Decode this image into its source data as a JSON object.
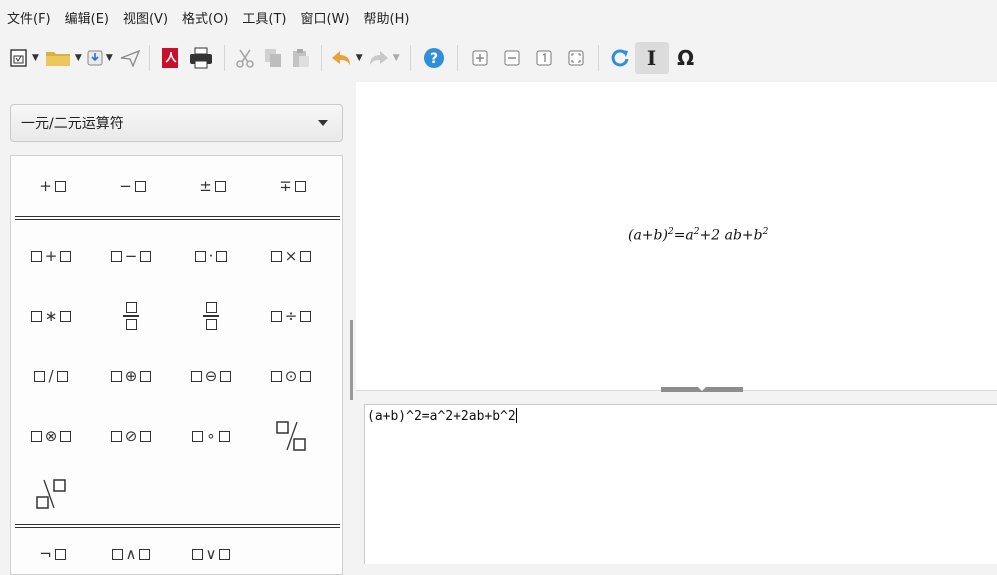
{
  "menu": [
    "文件(F)",
    "编辑(E)",
    "视图(V)",
    "格式(O)",
    "工具(T)",
    "窗口(W)",
    "帮助(H)"
  ],
  "toolbar": {
    "icons": [
      "new-document-icon",
      "open-folder-icon",
      "save-icon",
      "send-icon",
      "export-pdf-icon",
      "print-icon",
      "cut-icon",
      "copy-icon",
      "paste-icon",
      "undo-icon",
      "redo-icon",
      "help-icon",
      "zoom-in-icon",
      "zoom-out-icon",
      "actual-size-icon",
      "fit-page-icon",
      "refresh-icon",
      "formula-cursor-icon",
      "symbols-icon"
    ],
    "formula_cursor_label": "I",
    "symbols_label": "Ω"
  },
  "category": {
    "selected": "一元/二元运算符"
  },
  "palette": {
    "unary": [
      "+",
      "−",
      "±",
      "∓"
    ],
    "binary_row1": [
      "+",
      "−",
      "·",
      "×"
    ],
    "binary_row2": [
      "∗",
      "÷"
    ],
    "binary_row3": [
      "/",
      "⊕",
      "⊖",
      "⊙"
    ],
    "binary_row4": [
      "⊗",
      "⊘",
      "∘"
    ],
    "logic": [
      "¬",
      "∧",
      "∨"
    ]
  },
  "preview": {
    "lhs": "(a+b)",
    "exp1": "2",
    "eq": "=a",
    "exp2": "2",
    "mid": "+2 ab+b",
    "exp3": "2"
  },
  "editor": {
    "text": "(a+b)^2=a^2+2ab+b^2"
  },
  "colors": {
    "accent_blue": "#2f8fd8",
    "preview_bg": "#ffffff",
    "panel_bg": "#f3f3f3"
  }
}
